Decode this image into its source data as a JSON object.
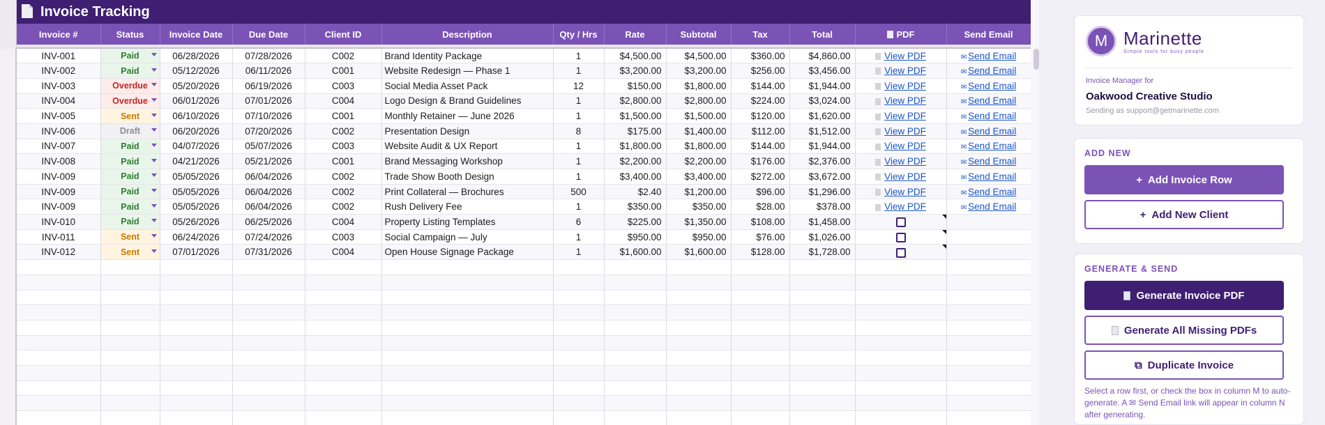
{
  "title": "Invoice Tracking",
  "columns": [
    "Invoice #",
    "Status",
    "Invoice Date",
    "Due Date",
    "Client ID",
    "Description",
    "Qty / Hrs",
    "Rate",
    "Subtotal",
    "Tax",
    "Total",
    "PDF",
    "Send Email"
  ],
  "pdf_link_label": "View PDF",
  "email_link_label": "Send Email",
  "rows": [
    {
      "inv": "INV-001",
      "status": "Paid",
      "idate": "06/28/2026",
      "ddate": "07/28/2026",
      "client": "C002",
      "desc": "Brand Identity Package",
      "qty": "1",
      "rate": "$4,500.00",
      "sub": "$4,500.00",
      "tax": "$360.00",
      "total": "$4,860.00",
      "pdf": "link"
    },
    {
      "inv": "INV-002",
      "status": "Paid",
      "idate": "05/12/2026",
      "ddate": "06/11/2026",
      "client": "C001",
      "desc": "Website Redesign — Phase 1",
      "qty": "1",
      "rate": "$3,200.00",
      "sub": "$3,200.00",
      "tax": "$256.00",
      "total": "$3,456.00",
      "pdf": "link"
    },
    {
      "inv": "INV-003",
      "status": "Overdue",
      "idate": "05/20/2026",
      "ddate": "06/19/2026",
      "client": "C003",
      "desc": "Social Media Asset Pack",
      "qty": "12",
      "rate": "$150.00",
      "sub": "$1,800.00",
      "tax": "$144.00",
      "total": "$1,944.00",
      "pdf": "link"
    },
    {
      "inv": "INV-004",
      "status": "Overdue",
      "idate": "06/01/2026",
      "ddate": "07/01/2026",
      "client": "C004",
      "desc": "Logo Design & Brand Guidelines",
      "qty": "1",
      "rate": "$2,800.00",
      "sub": "$2,800.00",
      "tax": "$224.00",
      "total": "$3,024.00",
      "pdf": "link"
    },
    {
      "inv": "INV-005",
      "status": "Sent",
      "idate": "06/10/2026",
      "ddate": "07/10/2026",
      "client": "C001",
      "desc": "Monthly Retainer — June 2026",
      "qty": "1",
      "rate": "$1,500.00",
      "sub": "$1,500.00",
      "tax": "$120.00",
      "total": "$1,620.00",
      "pdf": "link"
    },
    {
      "inv": "INV-006",
      "status": "Draft",
      "idate": "06/20/2026",
      "ddate": "07/20/2026",
      "client": "C002",
      "desc": "Presentation Design",
      "qty": "8",
      "rate": "$175.00",
      "sub": "$1,400.00",
      "tax": "$112.00",
      "total": "$1,512.00",
      "pdf": "link"
    },
    {
      "inv": "INV-007",
      "status": "Paid",
      "idate": "04/07/2026",
      "ddate": "05/07/2026",
      "client": "C003",
      "desc": "Website Audit & UX Report",
      "qty": "1",
      "rate": "$1,800.00",
      "sub": "$1,800.00",
      "tax": "$144.00",
      "total": "$1,944.00",
      "pdf": "link"
    },
    {
      "inv": "INV-008",
      "status": "Paid",
      "idate": "04/21/2026",
      "ddate": "05/21/2026",
      "client": "C001",
      "desc": "Brand Messaging Workshop",
      "qty": "1",
      "rate": "$2,200.00",
      "sub": "$2,200.00",
      "tax": "$176.00",
      "total": "$2,376.00",
      "pdf": "link"
    },
    {
      "inv": "INV-009",
      "status": "Paid",
      "idate": "05/05/2026",
      "ddate": "06/04/2026",
      "client": "C002",
      "desc": "Trade Show Booth Design",
      "qty": "1",
      "rate": "$3,400.00",
      "sub": "$3,400.00",
      "tax": "$272.00",
      "total": "$3,672.00",
      "pdf": "link"
    },
    {
      "inv": "INV-009",
      "status": "Paid",
      "idate": "05/05/2026",
      "ddate": "06/04/2026",
      "client": "C002",
      "desc": "Print Collateral — Brochures",
      "qty": "500",
      "rate": "$2.40",
      "sub": "$1,200.00",
      "tax": "$96.00",
      "total": "$1,296.00",
      "pdf": "link"
    },
    {
      "inv": "INV-009",
      "status": "Paid",
      "idate": "05/05/2026",
      "ddate": "06/04/2026",
      "client": "C002",
      "desc": "Rush Delivery Fee",
      "qty": "1",
      "rate": "$350.00",
      "sub": "$350.00",
      "tax": "$28.00",
      "total": "$378.00",
      "pdf": "link"
    },
    {
      "inv": "INV-010",
      "status": "Paid",
      "idate": "05/26/2026",
      "ddate": "06/25/2026",
      "client": "C004",
      "desc": "Property Listing Templates",
      "qty": "6",
      "rate": "$225.00",
      "sub": "$1,350.00",
      "tax": "$108.00",
      "total": "$1,458.00",
      "pdf": "checkbox"
    },
    {
      "inv": "INV-011",
      "status": "Sent",
      "idate": "06/24/2026",
      "ddate": "07/24/2026",
      "client": "C003",
      "desc": "Social Campaign — July",
      "qty": "1",
      "rate": "$950.00",
      "sub": "$950.00",
      "tax": "$76.00",
      "total": "$1,026.00",
      "pdf": "checkbox"
    },
    {
      "inv": "INV-012",
      "status": "Sent",
      "idate": "07/01/2026",
      "ddate": "07/31/2026",
      "client": "C004",
      "desc": "Open House Signage Package",
      "qty": "1",
      "rate": "$1,600.00",
      "sub": "$1,600.00",
      "tax": "$128.00",
      "total": "$1,728.00",
      "pdf": "checkbox"
    }
  ],
  "empty_rows": 11,
  "sidebar": {
    "avatar_letter": "M",
    "brand_name": "Marinette",
    "brand_tagline": "Simple tools for busy people",
    "manager_label": "Invoice Manager for",
    "studio_name": "Oakwood Creative Studio",
    "sending_as": "Sending as support@getmarinette.com",
    "add_section": "ADD NEW",
    "add_invoice_row": "Add Invoice Row",
    "add_new_client": "Add New Client",
    "gen_section": "GENERATE & SEND",
    "generate_pdf": "Generate Invoice PDF",
    "generate_all": "Generate All Missing PDFs",
    "duplicate": "Duplicate Invoice",
    "help_text": "Select a row first, or check the box in column M to auto-generate. A ✉ Send Email link will appear in column N after generating."
  },
  "colors": {
    "primary": "#7b52b6",
    "dark": "#3e1f72",
    "paid": "#2e7d32",
    "overdue": "#c62828",
    "sent": "#c77800",
    "draft": "#8b8d94",
    "link": "#1a56c9"
  }
}
